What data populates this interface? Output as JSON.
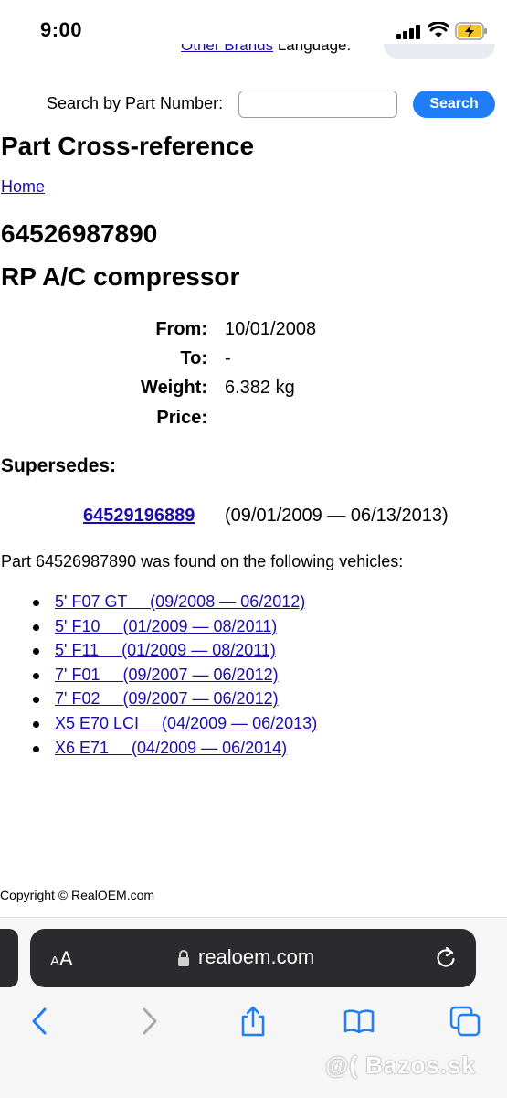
{
  "status": {
    "time": "9:00"
  },
  "topclip": {
    "brands_link": "Other Brands",
    "language_label": "Language:"
  },
  "search": {
    "label": "Search by Part Number:",
    "value": "",
    "placeholder": "",
    "button": "Search"
  },
  "page": {
    "title": "Part Cross-reference",
    "home_link": "Home",
    "part_number": "64526987890",
    "part_name": "RP A/C compressor"
  },
  "details": [
    {
      "label": "From:",
      "value": "10/01/2008"
    },
    {
      "label": "To:",
      "value": "-"
    },
    {
      "label": "Weight:",
      "value": "6.382 kg"
    },
    {
      "label": "Price:",
      "value": ""
    }
  ],
  "supersedes": {
    "heading": "Supersedes:",
    "part_link": "64529196889",
    "date_range": "(09/01/2009 — 06/13/2013)"
  },
  "vehicles": {
    "intro": "Part 64526987890 was found on the following vehicles:",
    "items": [
      "5' F07 GT     (09/2008 — 06/2012)",
      "5' F10     (01/2009 — 08/2011)",
      "5' F11     (01/2009 — 08/2011)",
      "7' F01     (09/2007 — 06/2012)",
      "7' F02     (09/2007 — 06/2012)",
      "X5 E70 LCI     (04/2009 — 06/2013)",
      "X6 E71     (04/2009 — 06/2014)"
    ]
  },
  "footer": {
    "copyright": "Copyright © RealOEM.com"
  },
  "browser": {
    "aa_small": "A",
    "aa_large": "A",
    "url": "realoem.com"
  },
  "watermark": "@( Bazos.sk",
  "colors": {
    "link": "#1a0dab",
    "search_button": "#1f7ef5",
    "url_bar": "#2b2b2d"
  }
}
